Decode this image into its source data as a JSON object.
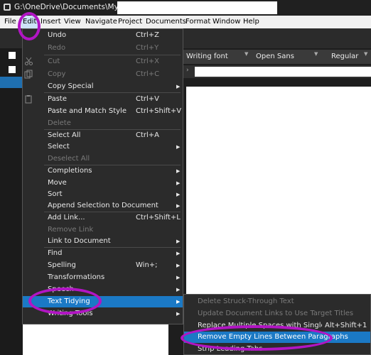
{
  "window": {
    "title": "G:\\OneDrive\\Documents\\My Novels\\"
  },
  "menubar": {
    "items": [
      "File",
      "Edit",
      "Insert",
      "View",
      "Navigate",
      "Project",
      "Documents",
      "Format",
      "Window",
      "Help"
    ]
  },
  "format_bar": {
    "style": "Writing font",
    "font": "Open Sans",
    "weight": "Regular"
  },
  "edit_menu": {
    "items": [
      {
        "label": "Undo",
        "shortcut": "Ctrl+Z",
        "disabled": false
      },
      {
        "label": "Redo",
        "shortcut": "Ctrl+Y",
        "disabled": true
      },
      {
        "label": "Cut",
        "shortcut": "Ctrl+X",
        "disabled": true
      },
      {
        "label": "Copy",
        "shortcut": "Ctrl+C",
        "disabled": true
      },
      {
        "label": "Copy Special",
        "shortcut": "",
        "disabled": false
      },
      {
        "label": "Paste",
        "shortcut": "Ctrl+V",
        "disabled": false
      },
      {
        "label": "Paste and Match Style",
        "shortcut": "Ctrl+Shift+V",
        "disabled": false
      },
      {
        "label": "Delete",
        "shortcut": "",
        "disabled": true
      },
      {
        "label": "Select All",
        "shortcut": "Ctrl+A",
        "disabled": false
      },
      {
        "label": "Select",
        "shortcut": "",
        "disabled": false
      },
      {
        "label": "Deselect All",
        "shortcut": "",
        "disabled": true
      },
      {
        "label": "Completions",
        "shortcut": "",
        "disabled": false
      },
      {
        "label": "Move",
        "shortcut": "",
        "disabled": false
      },
      {
        "label": "Sort",
        "shortcut": "",
        "disabled": false
      },
      {
        "label": "Append Selection to Document",
        "shortcut": "",
        "disabled": false
      },
      {
        "label": "Add Link...",
        "shortcut": "Ctrl+Shift+L",
        "disabled": false
      },
      {
        "label": "Remove Link",
        "shortcut": "",
        "disabled": true
      },
      {
        "label": "Link to Document",
        "shortcut": "",
        "disabled": false
      },
      {
        "label": "Find",
        "shortcut": "",
        "disabled": false
      },
      {
        "label": "Spelling",
        "shortcut": "Win+;",
        "disabled": false
      },
      {
        "label": "Transformations",
        "shortcut": "",
        "disabled": false
      },
      {
        "label": "Speech",
        "shortcut": "",
        "disabled": false
      },
      {
        "label": "Text Tidying",
        "shortcut": "",
        "disabled": false
      },
      {
        "label": "Writing Tools",
        "shortcut": "",
        "disabled": false
      }
    ]
  },
  "text_tidying_menu": {
    "items": [
      {
        "label": "Delete Struck-Through Text",
        "shortcut": "",
        "disabled": true
      },
      {
        "label": "Update Document Links to Use Target Titles",
        "shortcut": "",
        "disabled": true
      },
      {
        "label": "Replace Multiple Spaces with Single Spaces",
        "shortcut": "Alt+Shift+1",
        "disabled": false
      },
      {
        "label": "Remove Empty Lines Between Paragraphs",
        "shortcut": "",
        "disabled": false
      },
      {
        "label": "Strip Leading Tabs",
        "shortcut": "",
        "disabled": false
      }
    ]
  },
  "colors": {
    "highlight": "#1b79c5",
    "annotation": "#b215c4"
  }
}
